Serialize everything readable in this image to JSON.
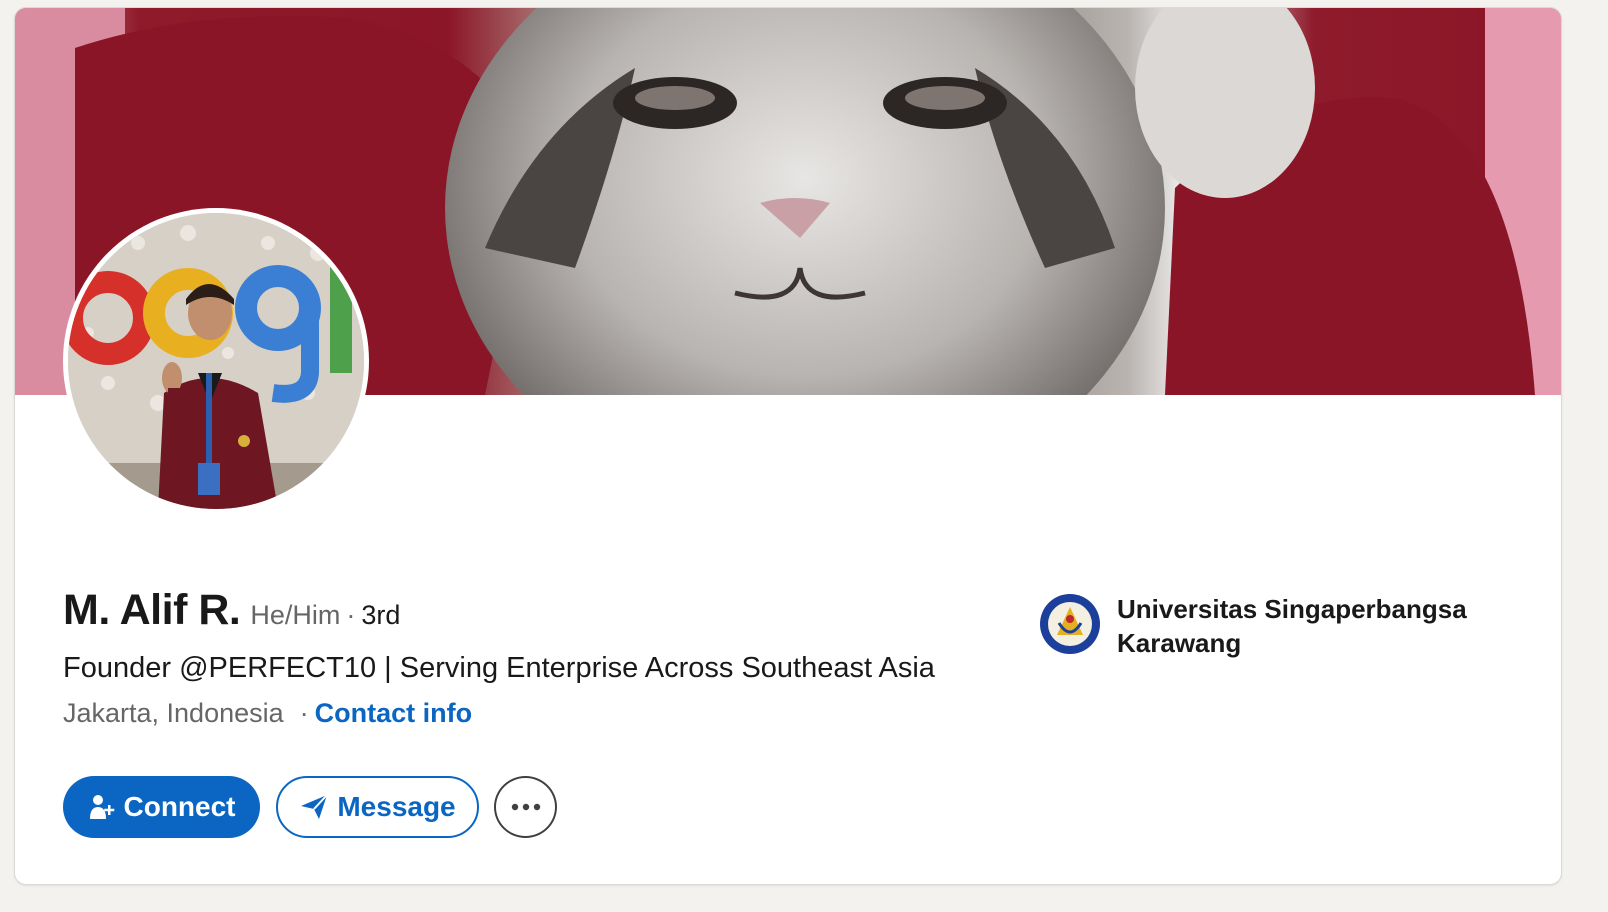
{
  "profile": {
    "name": "M. Alif R.",
    "pronouns": "He/Him",
    "degree_separator": "·",
    "degree": "3rd",
    "headline": "Founder @PERFECT10 | Serving Enterprise Across Southeast Asia",
    "location": "Jakarta, Indonesia",
    "location_separator": "·",
    "contact_info_label": "Contact info"
  },
  "education": {
    "school_name": "Universitas Singaperbangsa Karawang",
    "logo_icon": "university-seal-icon"
  },
  "actions": {
    "connect_label": "Connect",
    "connect_icon": "add-person-icon",
    "message_label": "Message",
    "message_icon": "paper-plane-icon",
    "more_icon": "more-horizontal-icon"
  },
  "colors": {
    "accent": "#0a66c2",
    "text_primary": "#191919",
    "text_secondary": "#666666",
    "page_background": "#f4f2ee"
  }
}
